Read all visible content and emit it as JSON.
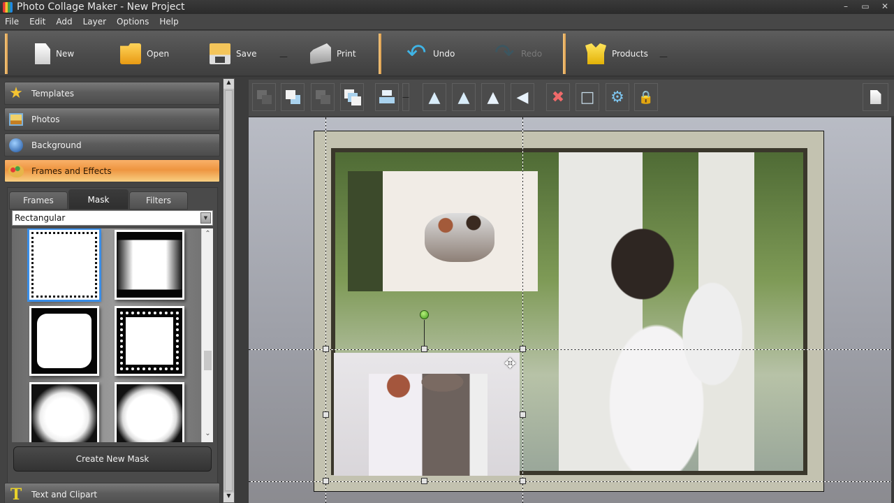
{
  "window": {
    "title": "Photo Collage Maker - New Project",
    "controls": [
      "minimize",
      "maximize",
      "close"
    ]
  },
  "menu": [
    "File",
    "Edit",
    "Add",
    "Layer",
    "Options",
    "Help"
  ],
  "toolbar": {
    "new": "New",
    "open": "Open",
    "save": "Save",
    "print": "Print",
    "undo": "Undo",
    "redo": "Redo",
    "products": "Products"
  },
  "sidebar": {
    "sections": [
      {
        "label": "Templates",
        "icon": "star-icon"
      },
      {
        "label": "Photos",
        "icon": "photo-icon"
      },
      {
        "label": "Background",
        "icon": "background-icon"
      },
      {
        "label": "Frames and Effects",
        "icon": "palette-icon",
        "active": true
      },
      {
        "label": "Text and Clipart",
        "icon": "text-icon"
      }
    ],
    "tabs": [
      "Frames",
      "Mask",
      "Filters"
    ],
    "active_tab": "Mask",
    "mask_type": "Rectangular",
    "masks": [
      {
        "name": "stamp-edge",
        "selected": true
      },
      {
        "name": "soft-vertical"
      },
      {
        "name": "torn-edge"
      },
      {
        "name": "dotted-border"
      },
      {
        "name": "blur-soft"
      },
      {
        "name": "grainy-edge"
      }
    ],
    "create_mask_label": "Create New Mask"
  },
  "edit_toolbar": {
    "buttons": [
      "send-backward",
      "bring-forward",
      "send-to-back",
      "bring-to-front",
      "align",
      "rotate-left",
      "rotate-right",
      "flip-horizontal",
      "flip-vertical",
      "delete",
      "crop",
      "settings",
      "lock"
    ],
    "page_button": "page"
  },
  "colors": {
    "accent": "#f0a050",
    "selection": "#3a8ee8",
    "page": "#c3c2b0"
  }
}
